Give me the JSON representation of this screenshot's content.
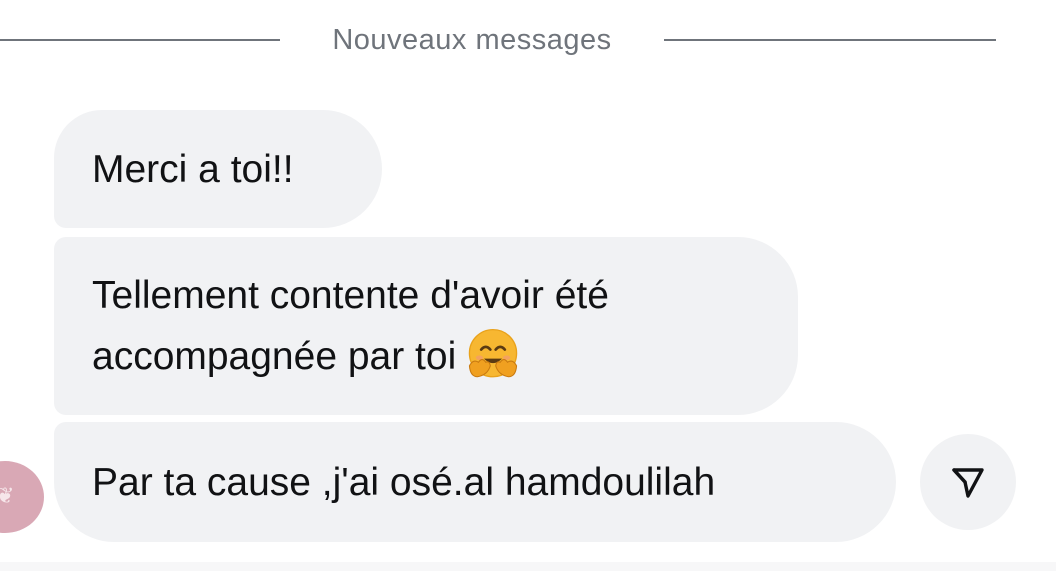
{
  "divider": {
    "label": "Nouveaux messages"
  },
  "messages": [
    {
      "text": "Merci a toi!!"
    },
    {
      "lines": [
        "Tellement contente d'avoir été",
        "accompagnée par toi"
      ],
      "emoji": "hugging-face-emoji"
    },
    {
      "text": "Par ta cause ,j'ai osé.al hamdoulilah"
    }
  ],
  "colors": {
    "bubble_bg": "#f1f2f4",
    "text": "#111214",
    "divider": "#6f747b",
    "avatar_bg": "#d9a8b5",
    "emoji_face": "#f7b731"
  },
  "icons": {
    "send": "paper-plane-icon",
    "avatar": "avatar"
  }
}
